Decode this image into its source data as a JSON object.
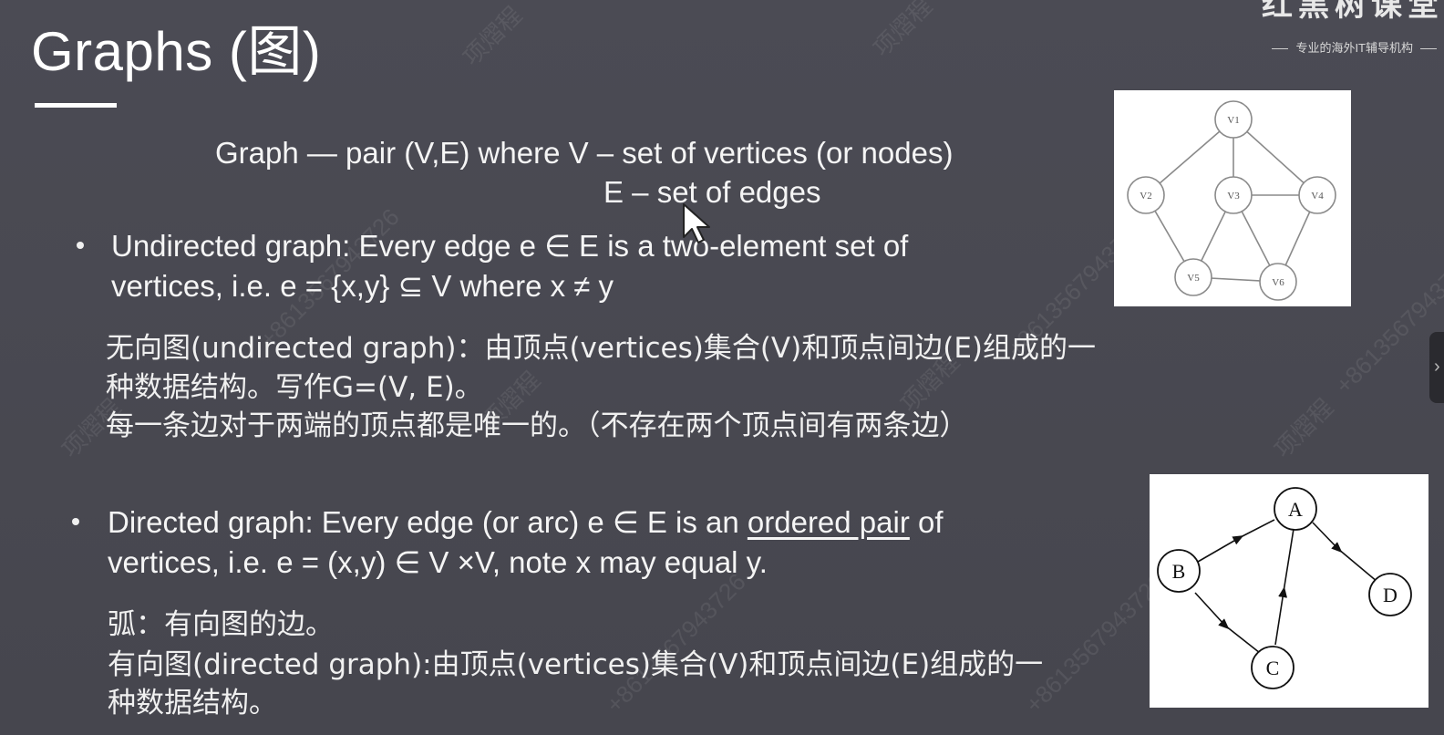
{
  "slide": {
    "title": "Graphs (图)",
    "brand": {
      "name": "红黑树课堂",
      "slogan": "专业的海外IT辅导机构"
    },
    "definition": {
      "line1": "Graph — pair (V,E) where V – set of vertices (or nodes)",
      "line2": "E – set of edges"
    },
    "undirected": {
      "line1": "Undirected graph: Every edge e ∈ E is a two-element set of",
      "line2": "vertices, i.e. e = {x,y} ⊆ V where x ≠ y",
      "cn1": "无向图(undirected graph)：由顶点(vertices)集合(V)和顶点间边(E)组成的一",
      "cn2": "种数据结构。写作G=(V, E)。",
      "cn3": "每一条边对于两端的顶点都是唯一的。（不存在两个顶点间有两条边）"
    },
    "directed": {
      "line1_pre": "Directed graph: Every edge (or arc) e ∈ E is an ",
      "line1_underlined": "ordered pair",
      "line1_post": " of",
      "line2": "vertices, i.e. e = (x,y) ∈ V ×V, note x may equal y.",
      "cn1": "弧：有向图的边。",
      "cn2": "有向图(directed graph):由顶点(vertices)集合(V)和顶点间边(E)组成的一",
      "cn3": "种数据结构。"
    },
    "undirected_figure": {
      "nodes": [
        "V1",
        "V2",
        "V3",
        "V4",
        "V5",
        "V6"
      ]
    },
    "directed_figure": {
      "nodes": [
        "A",
        "B",
        "C",
        "D"
      ]
    },
    "side_tab_icon": "chevron-right-icon",
    "side_tab_glyph": "›",
    "watermarks": [
      "项熠程",
      "+8613567943726"
    ]
  }
}
